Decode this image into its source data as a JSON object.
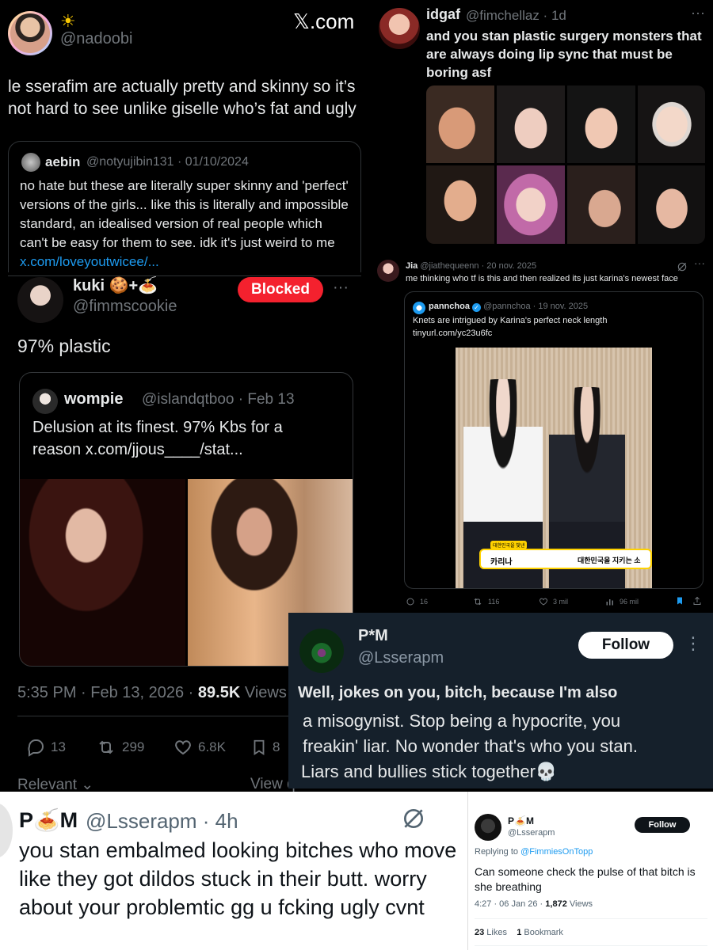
{
  "p1": {
    "sun": "☀",
    "handle": "@nadoobi",
    "xcom": "𝕏.com",
    "text": "le sserafim are actually pretty and skinny so it’s not hard to see unlike giselle who’s fat and ugly",
    "quote": {
      "name": "aebin",
      "handle_date": "@notyujibin131 · 01/10/2024",
      "text": "no hate but these are literally super skinny and 'perfect' versions of the girls... like this is literally and impossible standard, an idealised version of real people which can't be easy for them to see. idk it's just weird to me",
      "link": "x.com/loveyoutwicee/..."
    }
  },
  "p2": {
    "name": "idgaf",
    "handle_time": "@fimchellaz · 1d",
    "more": "···",
    "text": "and you stan plastic surgery monsters that are always doing lip sync that must be boring asf"
  },
  "p3": {
    "name": "kuki 🍪+🍝",
    "handle": "@fimmscookie",
    "blocked": "Blocked",
    "more": "···",
    "text": "97% plastic",
    "quote": {
      "name": "wompie",
      "handle_date": "@islandqtboo · Feb 13",
      "text_line1": "Delusion at its finest. 97% Kbs for a",
      "text_line2": "reason  x.com/jjous____/stat..."
    },
    "meta_time": "5:35 PM · Feb 13, 2026 · ",
    "views_num": "89.5K",
    "views_label": " Views",
    "replies": "13",
    "reposts": "299",
    "likes": "6.8K",
    "bookmarks": "8",
    "relevant": "Relevant",
    "view_quotes": "View quotes >"
  },
  "p4": {
    "name": "Jia",
    "handle_date": "@jiathequeenn · 20 nov. 2025",
    "text": "me thinking who tf is this and then realized its just karina's newest face",
    "quote": {
      "name": "pannchoa",
      "handle_date": "@pannchoa · 19 nov. 2025",
      "text": "Knets are intrigued by Karina's perfect neck length",
      "link": "tinyurl.com/yc23u6fc",
      "caption_small": "대한민국을 빛낸",
      "caption_name": "카리나",
      "caption_right": "대한민국을 지키는 소"
    },
    "replies": "16",
    "reposts": "116",
    "likes": "3 mil",
    "views": "96 mil"
  },
  "p5": {
    "name": "P*M",
    "handle": "@Lsserapm",
    "follow": "Follow",
    "more": "⋮",
    "text_line1": "Well, jokes on you, bitch, because I'm also",
    "text_line2": "a misogynist. Stop being a hypocrite, you",
    "text_line3": "freakin' liar. No wonder that's who you stan.",
    "text_line4": "Liars and bullies stick together💀"
  },
  "p6": {
    "name": "P🍝M",
    "handle_time": "@Lsserapm · 4h",
    "text": "you stan embalmed looking bitches who move like they got dildos stuck in their butt. worry about your problemtic gg u fcking ugly cvnt"
  },
  "p7": {
    "name": "P🍝M",
    "handle": "@Lsserapm",
    "follow": "Follow",
    "replying_label": "Replying to ",
    "replying_to": "@FimmiesOnTopp",
    "text": "Can someone check the pulse of that bitch is she breathing",
    "meta_time": "4:27 · 06 Jan 26 · ",
    "views_num": "1,872",
    "views_label": " Views",
    "likes_num": "23",
    "likes_label": " Likes",
    "bookmarks_num": "1",
    "bookmarks_label": " Bookmark"
  },
  "colors": {
    "background": "#000000",
    "text": "#e7e9ea",
    "muted": "#71767b",
    "link": "#1d9bf0",
    "blocked": "#f4212e",
    "dim_panel": "#15202b"
  }
}
